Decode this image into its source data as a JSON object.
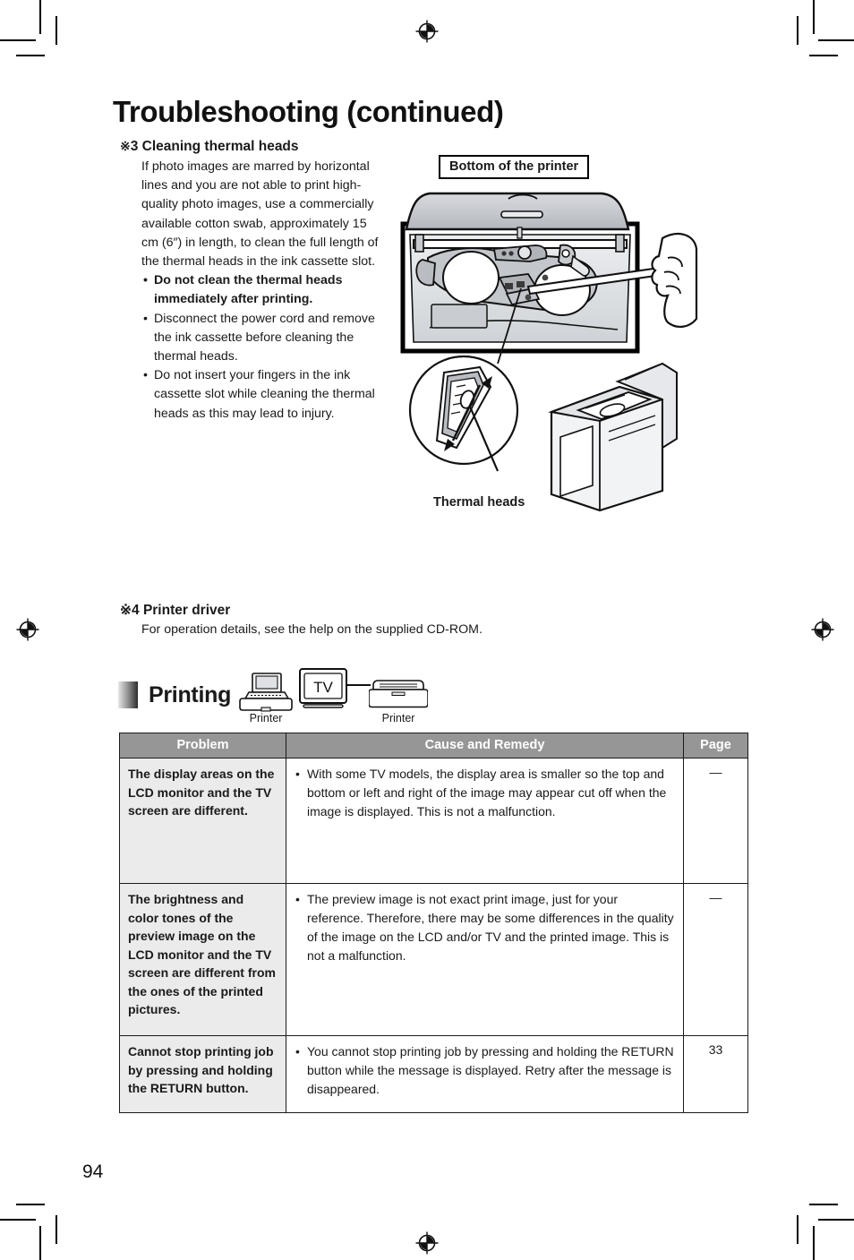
{
  "document": {
    "title": "Troubleshooting (continued)",
    "page_number": "94"
  },
  "section_3": {
    "marker": "※",
    "number": "3",
    "heading": "Cleaning thermal heads",
    "paragraph": "If photo images are marred by horizontal lines and you are not able to print high-quality photo images, use a commercially available cotton swab, approximately 15 cm (6″) in length, to clean the full length of the thermal heads in the ink cassette slot.",
    "bullet_marker": "•",
    "bullets": [
      {
        "text": "Do not clean the thermal heads immediately after printing.",
        "bold": true
      },
      {
        "text": "Disconnect the power cord and remove the ink cassette before cleaning the thermal heads.",
        "bold": false
      },
      {
        "text": "Do not insert your fingers in the ink cassette slot while cleaning the thermal heads as this may lead to injury.",
        "bold": false
      }
    ]
  },
  "illustration": {
    "top_caption": "Bottom of the printer",
    "bottom_caption": "Thermal heads"
  },
  "section_4": {
    "marker": "※",
    "number": "4",
    "heading": "Printer driver",
    "paragraph": "For operation details, see the help on the supplied CD-ROM."
  },
  "printing_section": {
    "title": "Printing",
    "devices": [
      {
        "icon": "laptop-printer-icon",
        "label": "Printer"
      },
      {
        "icon": "tv-icon",
        "label": "TV"
      },
      {
        "icon": "printer-icon",
        "label": "Printer"
      }
    ],
    "tv_screen_text": "TV"
  },
  "table": {
    "headers": {
      "problem": "Problem",
      "cause": "Cause and Remedy",
      "page": "Page"
    },
    "bullet_marker": "•",
    "rows": [
      {
        "problem": "The display areas on the LCD monitor and the TV screen are different.",
        "cause": "With some TV models, the display area is smaller so the top and bottom or left and right of the image may appear cut off when the image is displayed. This is not a malfunction.",
        "page": "—"
      },
      {
        "problem": "The brightness and color tones of the preview image on the LCD monitor and the TV screen are different from the ones of the printed pictures.",
        "cause": "The preview image is not exact print image, just for your reference. Therefore, there may be some differences in the quality of the image on the LCD and/or TV and the printed image. This is not a malfunction.",
        "page": "—"
      },
      {
        "problem": "Cannot stop printing job by pressing and holding the RETURN button.",
        "cause": "You cannot stop printing job by pressing and holding the RETURN button while the message is displayed. Retry after the message is disappeared.",
        "page": "33"
      }
    ]
  },
  "colors": {
    "header_gray": "#969696",
    "problem_cell_gray": "#ebebeb",
    "text": "#1a1a1a"
  }
}
